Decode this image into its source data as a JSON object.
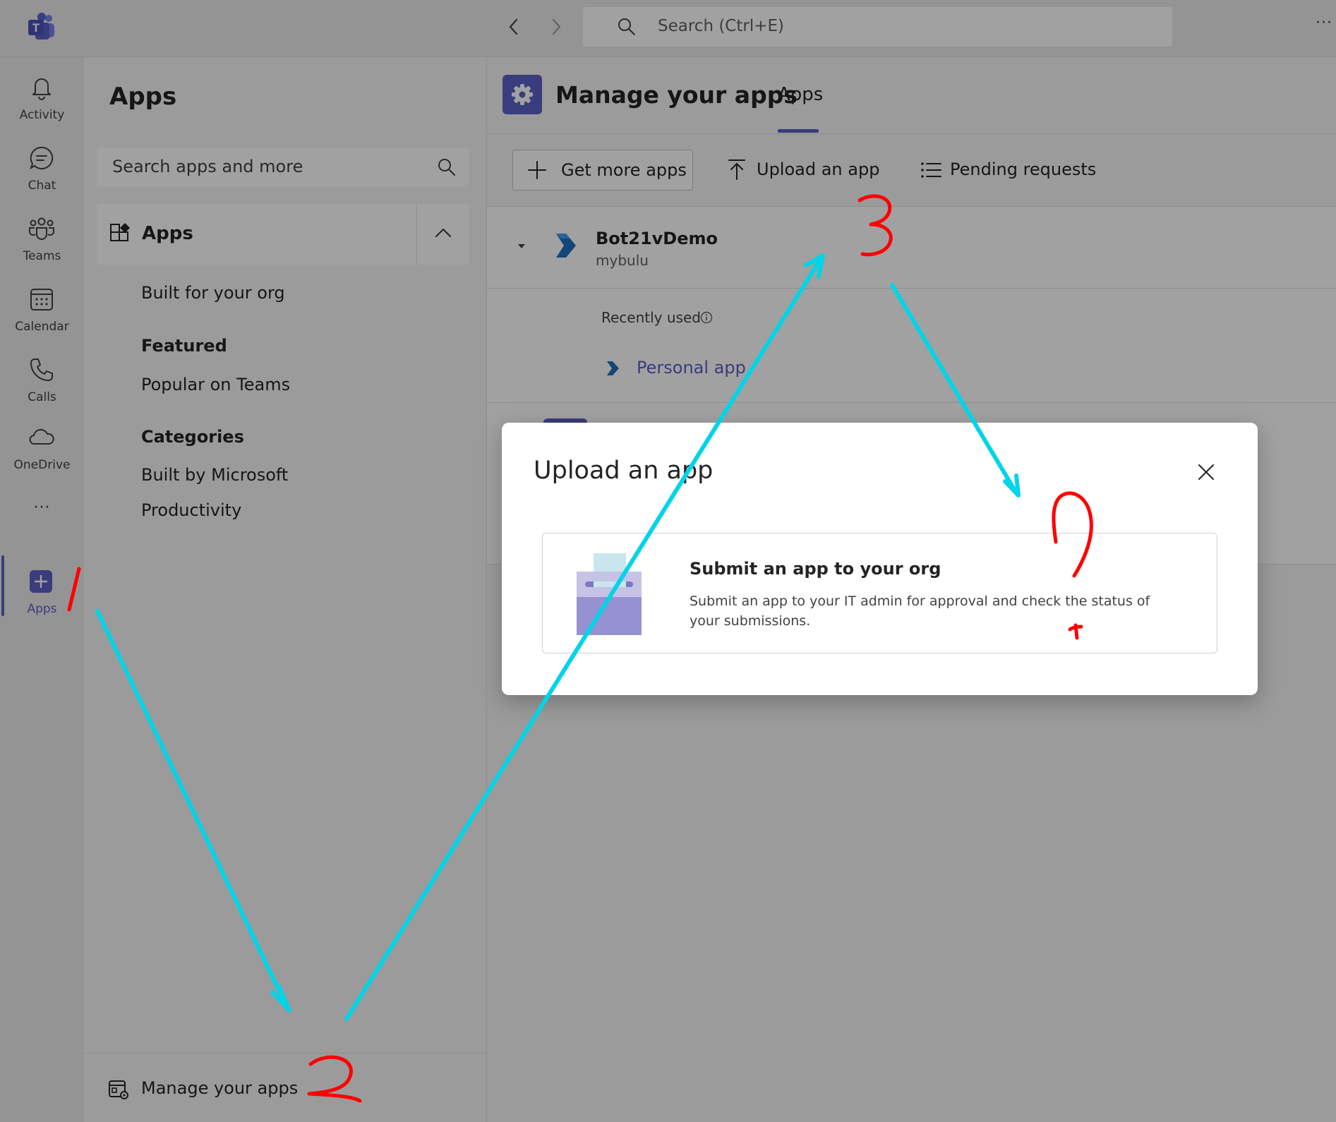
{
  "titlebar": {
    "search_placeholder": "Search (Ctrl+E)",
    "more_label": "···"
  },
  "rail": {
    "items": [
      {
        "label": "Activity"
      },
      {
        "label": "Chat"
      },
      {
        "label": "Teams"
      },
      {
        "label": "Calendar"
      },
      {
        "label": "Calls"
      },
      {
        "label": "OneDrive"
      },
      {
        "label": "Apps"
      }
    ],
    "more_label": "···"
  },
  "sidepane": {
    "title": "Apps",
    "search_placeholder": "Search apps and more",
    "section_label": "Apps",
    "built_for_org": "Built for your org",
    "featured_heading": "Featured",
    "popular": "Popular on Teams",
    "categories_heading": "Categories",
    "built_by_microsoft": "Built by Microsoft",
    "productivity": "Productivity",
    "manage_label": "Manage your apps"
  },
  "main": {
    "title": "Manage your apps",
    "tab_label": "Apps",
    "get_more": "Get more apps",
    "upload": "Upload an app",
    "pending": "Pending requests",
    "app_name": "Bot21vDemo",
    "app_publisher": "mybulu",
    "recently_used": "Recently used",
    "personal_app": "Personal app"
  },
  "dialog": {
    "title": "Upload an app",
    "card_title": "Submit an app to your org",
    "card_desc": "Submit an app to your IT admin for approval and check the status of your submissions."
  },
  "colors": {
    "brand": "#5b5fc7",
    "annotation_red": "#ff0000",
    "annotation_cyan": "#00d4e8"
  }
}
